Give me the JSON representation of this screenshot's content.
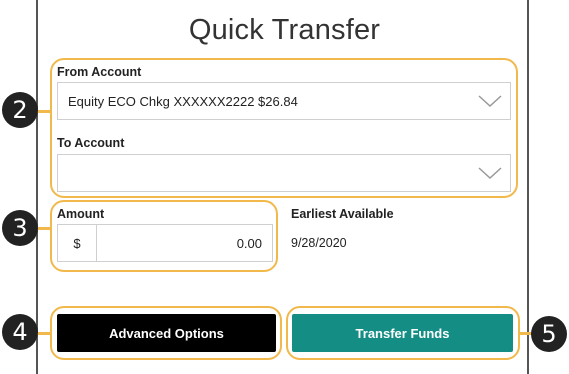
{
  "header": {
    "title": "Quick Transfer"
  },
  "from_account": {
    "label": "From Account",
    "value": "Equity ECO Chkg XXXXXX2222 $26.84"
  },
  "to_account": {
    "label": "To Account",
    "value": ""
  },
  "amount": {
    "label": "Amount",
    "currency": "$",
    "value": "0.00"
  },
  "earliest": {
    "label": "Earliest Available",
    "date": "9/28/2020"
  },
  "buttons": {
    "advanced": "Advanced Options",
    "transfer": "Transfer Funds"
  },
  "callouts": [
    "2",
    "3",
    "4",
    "5"
  ],
  "colors": {
    "highlight": "#f1b94b",
    "advanced_bg": "#000000",
    "transfer_bg": "#148e84",
    "badge_bg": "#222222"
  }
}
